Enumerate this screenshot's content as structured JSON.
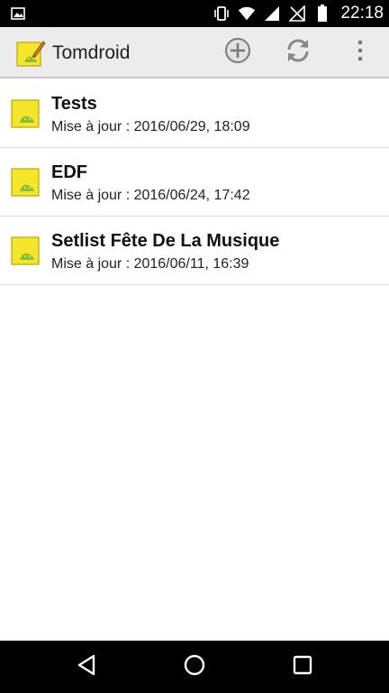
{
  "status_bar": {
    "time": "22:18",
    "icons": [
      "image-notification-icon",
      "vibrate-icon",
      "wifi-icon",
      "signal-icon",
      "no-signal-icon",
      "battery-icon"
    ]
  },
  "action_bar": {
    "title": "Tomdroid",
    "app_icon": "tomdroid-note-icon",
    "actions": [
      "add-circle-icon",
      "sync-icon",
      "overflow-menu-icon"
    ]
  },
  "notes": [
    {
      "title": "Tests",
      "date": "Mise à jour : 2016/06/29, 18:09"
    },
    {
      "title": "EDF",
      "date": "Mise à jour : 2016/06/24, 17:42"
    },
    {
      "title": "Setlist Fête De La Musique",
      "date": "Mise à jour : 2016/06/11, 16:39"
    }
  ],
  "nav_bar": {
    "buttons": [
      "back-icon",
      "home-icon",
      "recents-icon"
    ]
  },
  "colors": {
    "action_bar_bg": "#ececec",
    "note_yellow": "#f5e62a",
    "android_green": "#8bbd3c"
  }
}
